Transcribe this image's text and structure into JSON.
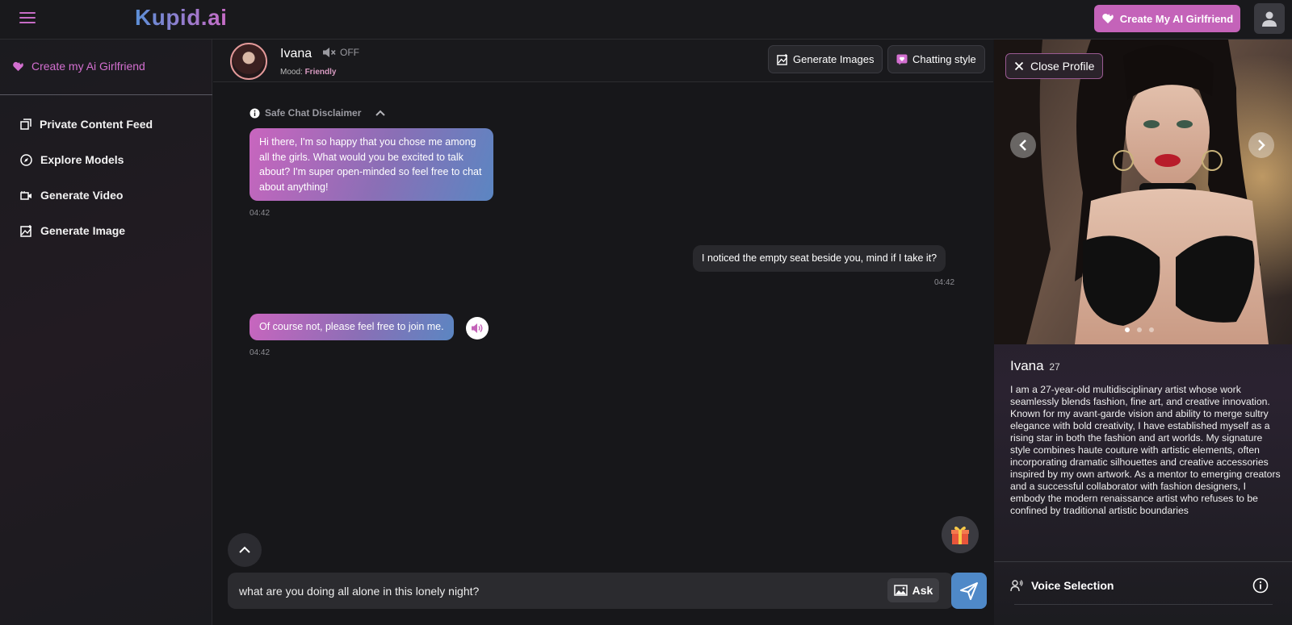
{
  "topbar": {
    "logo": "Kupid.ai",
    "cta_label": "Create My AI Girlfriend"
  },
  "sidebar": {
    "create_label": "Create my Ai Girlfriend",
    "items": [
      {
        "label": "Private Content Feed",
        "icon": "gallery-icon"
      },
      {
        "label": "Explore Models",
        "icon": "compass-icon"
      },
      {
        "label": "Generate Video",
        "icon": "video-icon"
      },
      {
        "label": "Generate Image",
        "icon": "image-icon"
      }
    ]
  },
  "chat_header": {
    "name": "Ivana",
    "mute_status": "OFF",
    "mood_label": "Mood:",
    "mood_value": "Friendly",
    "generate_images_label": "Generate Images",
    "chatting_style_label": "Chatting style"
  },
  "messages": {
    "disclaimer": "Safe Chat Disclaimer",
    "list": [
      {
        "from": "bot",
        "text": "Hi there, I'm so happy that you chose me among all the girls. What would you be excited to talk about? I'm super open-minded so feel free to chat about anything!",
        "time": "04:42"
      },
      {
        "from": "user",
        "text": "I noticed the empty seat beside you, mind if I take it?",
        "time": "04:42"
      },
      {
        "from": "bot",
        "text": "Of course not, please feel free to join me.",
        "time": "04:42"
      }
    ]
  },
  "composer": {
    "value": "what are you doing all alone in this lonely night?",
    "ask_label": "Ask"
  },
  "profile": {
    "close_label": "Close Profile",
    "name": "Ivana",
    "age": "27",
    "bio": "I am a 27-year-old multidisciplinary artist whose work seamlessly blends fashion, fine art, and creative innovation. Known for my avant-garde vision and ability to merge sultry elegance with bold creativity, I have established myself as a rising star in both the fashion and art worlds. My signature style combines haute couture with artistic elements, often incorporating dramatic silhouettes and creative accessories inspired by my own artwork. As a mentor to emerging creators and a successful collaborator with fashion designers, I embody the modern renaissance artist who refuses to be confined by traditional artistic boundaries",
    "voice_label": "Voice Selection",
    "carousel_index": 1,
    "carousel_count": 3
  },
  "colors": {
    "accent_pink": "#c463b9",
    "accent_blue": "#4f89c8",
    "bg": "#17171a"
  }
}
